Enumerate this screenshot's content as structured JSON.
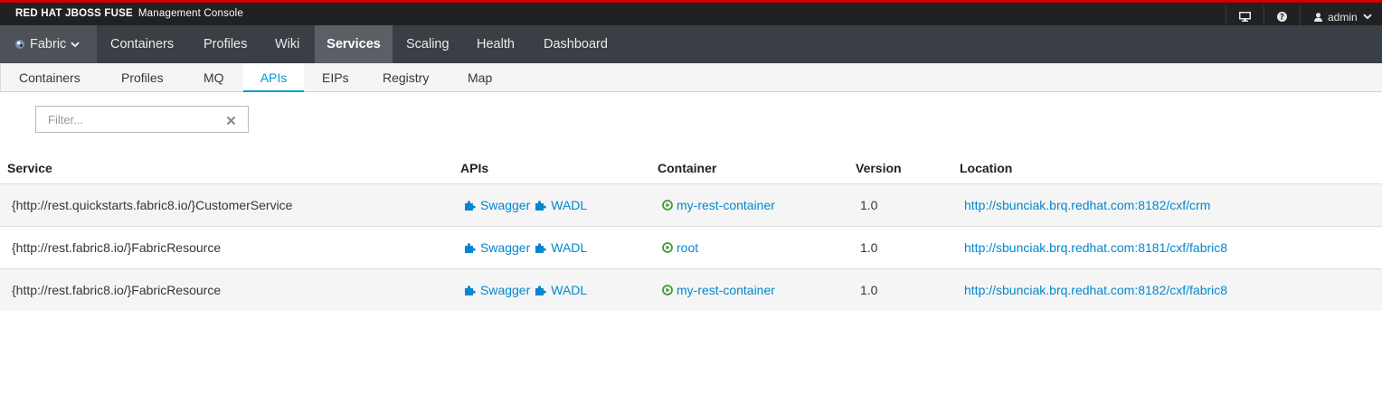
{
  "brand": {
    "product": "RED HAT JBOSS FUSE",
    "console": "Management Console"
  },
  "user_menu": {
    "username": "admin",
    "icons": [
      "monitor-icon",
      "question-icon",
      "user-icon",
      "chevron-down-icon"
    ]
  },
  "main_nav": {
    "fabric_label": "Fabric",
    "items": [
      "Containers",
      "Profiles",
      "Wiki",
      "Services",
      "Scaling",
      "Health",
      "Dashboard"
    ],
    "active": "Services"
  },
  "sub_nav": {
    "tabs": [
      "Containers",
      "Profiles",
      "MQ",
      "APIs",
      "EIPs",
      "Registry",
      "Map"
    ],
    "active": "APIs"
  },
  "filter": {
    "placeholder": "Filter...",
    "value": ""
  },
  "table": {
    "headers": {
      "service": "Service",
      "apis": "APIs",
      "container": "Container",
      "version": "Version",
      "location": "Location"
    },
    "rows": [
      {
        "service": "{http://rest.quickstarts.fabric8.io/}CustomerService",
        "api1": "Swagger",
        "api2": "WADL",
        "container": "my-rest-container",
        "version": "1.0",
        "location": "http://sbunciak.brq.redhat.com:8182/cxf/crm"
      },
      {
        "service": "{http://rest.fabric8.io/}FabricResource",
        "api1": "Swagger",
        "api2": "WADL",
        "container": "root",
        "version": "1.0",
        "location": "http://sbunciak.brq.redhat.com:8181/cxf/fabric8"
      },
      {
        "service": "{http://rest.fabric8.io/}FabricResource",
        "api1": "Swagger",
        "api2": "WADL",
        "container": "my-rest-container",
        "version": "1.0",
        "location": "http://sbunciak.brq.redhat.com:8182/cxf/fabric8"
      }
    ]
  },
  "colors": {
    "accent": "#0099d3",
    "link": "#0088ce",
    "container_status": "#3f9c35",
    "brand_stripe": "#cc0000"
  }
}
